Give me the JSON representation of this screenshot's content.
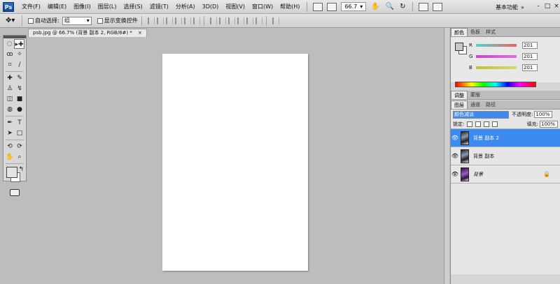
{
  "menubar": {
    "logo": "Ps",
    "items": [
      "文件(F)",
      "编辑(E)",
      "图像(I)",
      "图层(L)",
      "选择(S)",
      "滤镜(T)",
      "分析(A)",
      "3D(D)",
      "视图(V)",
      "窗口(W)",
      "帮助(H)"
    ],
    "zoom": "66.7",
    "workspace": "基本功能",
    "window_controls": [
      "-",
      "□",
      "×"
    ]
  },
  "options": {
    "auto_select_label": "自动选择:",
    "auto_select_value": "组",
    "transform_label": "显示变换控件"
  },
  "document": {
    "tab_title": "psb.jpg @ 66.7% (背景 副本 2, RGB/8#) *",
    "tab_close": "×"
  },
  "color_panel": {
    "tabs": [
      "颜色",
      "色板",
      "样式"
    ],
    "channels": [
      {
        "label": "R",
        "value": "201",
        "color": "#e05050"
      },
      {
        "label": "G",
        "value": "201",
        "color": "#c040c0"
      },
      {
        "label": "B",
        "value": "201",
        "color": "#c0c040"
      }
    ],
    "foreground_color": "#c9c9c9"
  },
  "adjust_tabs": [
    "调整",
    "蒙版"
  ],
  "layers_panel": {
    "tabs": [
      "图层",
      "通道",
      "路径"
    ],
    "blend_mode": "颜色减淡",
    "opacity_label": "不透明度:",
    "opacity_value": "100%",
    "lock_label": "锁定:",
    "fill_label": "填充:",
    "fill_value": "100%",
    "layers": [
      {
        "name": "背景 副本 2",
        "selected": true
      },
      {
        "name": "背景 副本",
        "selected": false
      },
      {
        "name": "背景",
        "selected": false
      }
    ]
  }
}
